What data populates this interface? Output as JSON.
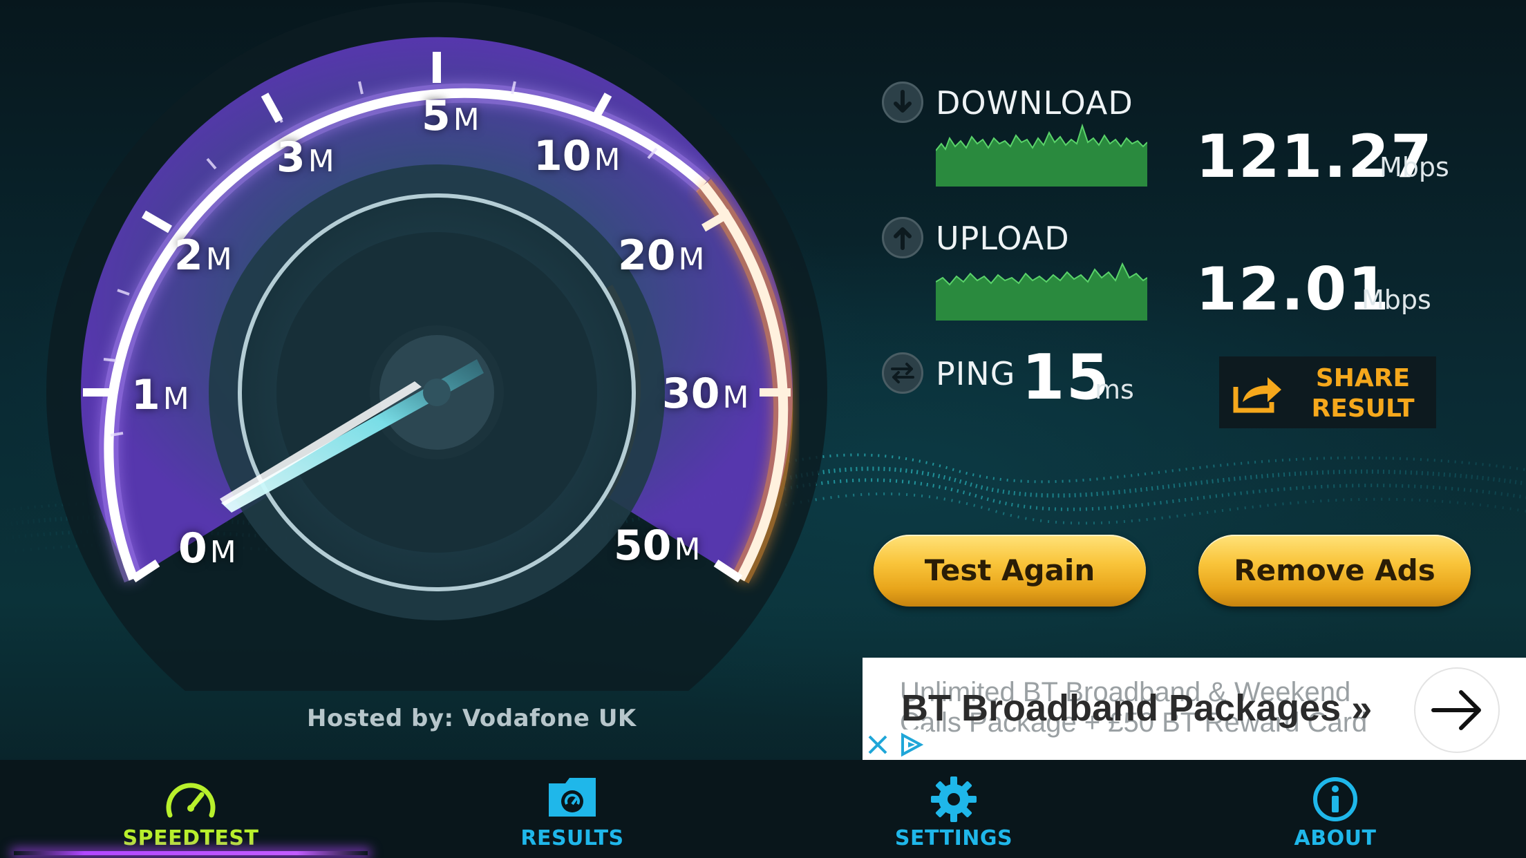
{
  "gauge": {
    "ticks": [
      {
        "value": "0",
        "unit": "M"
      },
      {
        "value": "1",
        "unit": "M"
      },
      {
        "value": "2",
        "unit": "M"
      },
      {
        "value": "3",
        "unit": "M"
      },
      {
        "value": "5",
        "unit": "M"
      },
      {
        "value": "10",
        "unit": "M"
      },
      {
        "value": "20",
        "unit": "M"
      },
      {
        "value": "30",
        "unit": "M"
      },
      {
        "value": "50",
        "unit": "M"
      }
    ],
    "hosted_by": "Hosted by: Vodafone UK"
  },
  "results": {
    "download": {
      "label": "DOWNLOAD",
      "value": "121.27",
      "unit": "Mbps"
    },
    "upload": {
      "label": "UPLOAD",
      "value": "12.01",
      "unit": "Mbps"
    },
    "ping": {
      "label": "PING",
      "value": "15",
      "unit": "ms"
    },
    "share_line1": "SHARE",
    "share_line2": "RESULT"
  },
  "buttons": {
    "test_again": "Test Again",
    "remove_ads": "Remove Ads"
  },
  "ad": {
    "line1": "Unlimited BT Broadband & Weekend",
    "line2": "Calls Package + £50 BT Reward Card",
    "headline": "BT Broadband Packages »"
  },
  "tabs": [
    {
      "label": "SPEEDTEST",
      "icon": "speedometer-icon",
      "active": true
    },
    {
      "label": "RESULTS",
      "icon": "results-folder-icon",
      "active": false
    },
    {
      "label": "SETTINGS",
      "icon": "gear-icon",
      "active": false
    },
    {
      "label": "ABOUT",
      "icon": "info-icon",
      "active": false
    }
  ],
  "colors": {
    "accent_orange": "#f5a81c",
    "gauge_purple": "#6a3fc8",
    "tab_blue": "#1fb7ea",
    "tab_active_green": "#b8f02c"
  }
}
